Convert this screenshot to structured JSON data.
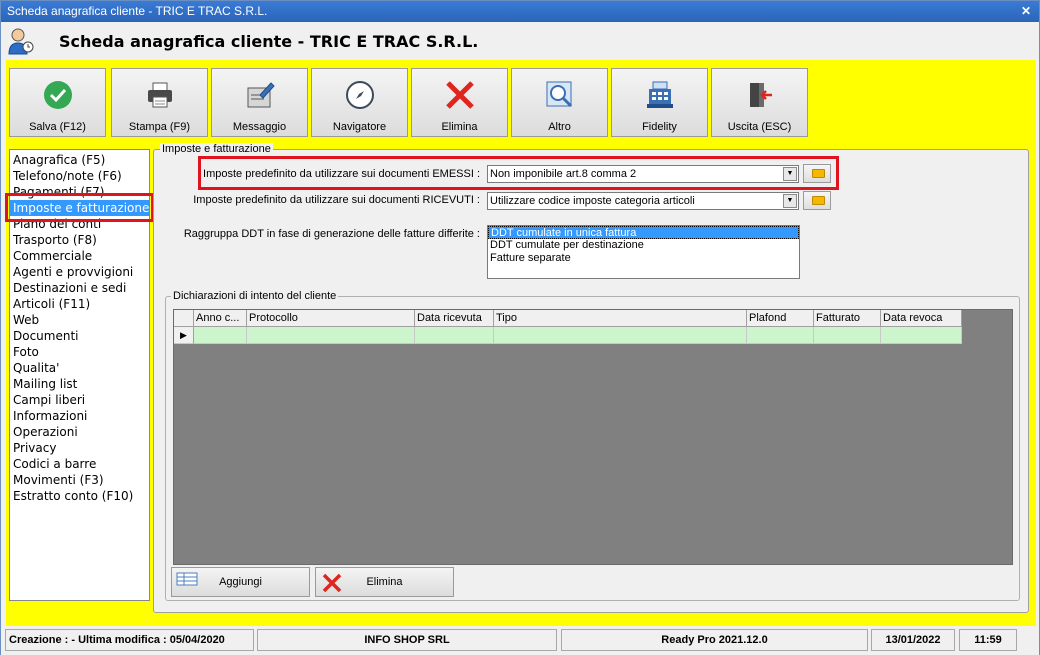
{
  "window": {
    "title": "Scheda anagrafica cliente - TRIC E TRAC S.R.L.",
    "close_glyph": "✕"
  },
  "header": {
    "title": "Scheda anagrafica cliente - TRIC E TRAC S.R.L."
  },
  "toolbar": [
    {
      "label": "Salva (F12)",
      "icon": "check-icon"
    },
    {
      "label": "Stampa (F9)",
      "icon": "printer-icon"
    },
    {
      "label": "Messaggio",
      "icon": "message-icon"
    },
    {
      "label": "Navigatore",
      "icon": "compass-icon"
    },
    {
      "label": "Elimina",
      "icon": "delete-icon"
    },
    {
      "label": "Altro",
      "icon": "search-icon"
    },
    {
      "label": "Fidelity",
      "icon": "cash-register-icon"
    },
    {
      "label": "Uscita (ESC)",
      "icon": "exit-icon"
    }
  ],
  "nav": {
    "items": [
      "Anagrafica (F5)",
      "Telefono/note (F6)",
      "Pagamenti (F7)",
      "Imposte e fatturazione",
      "Piano dei conti",
      "Trasporto (F8)",
      "Commerciale",
      "Agenti e provvigioni",
      "Destinazioni e sedi",
      "Articoli (F11)",
      "Web",
      "Documenti",
      "Foto",
      "Qualita'",
      "Mailing list",
      "Campi liberi",
      "Informazioni",
      "Operazioni",
      "Privacy",
      "Codici a barre",
      "Movimenti (F3)",
      "Estratto conto (F10)"
    ],
    "selected": "Imposte e fatturazione"
  },
  "imposte": {
    "section_title": "Imposte e fatturazione",
    "emessi_label": "Imposte predefinito da utilizzare sui documenti EMESSI :",
    "emessi_value": "Non imponibile art.8 comma 2",
    "ricevuti_label": "Imposte predefinito da utilizzare sui documenti RICEVUTI :",
    "ricevuti_value": "Utilizzare codice imposte categoria articoli",
    "raggruppa_label": "Raggruppa DDT in fase di generazione delle fatture differite :",
    "raggruppa_options": [
      "DDT cumulate in unica fattura",
      "DDT cumulate per destinazione",
      "Fatture separate"
    ],
    "raggruppa_selected": "DDT cumulate in unica fattura"
  },
  "dichiarazioni": {
    "section_title": "Dichiarazioni di intento del cliente",
    "columns": [
      "Anno c...",
      "Protocollo",
      "Data ricevuta",
      "Tipo",
      "Plafond",
      "Fatturato",
      "Data revoca"
    ],
    "row_indicator": "▶",
    "add_label": "Aggiungi",
    "delete_label": "Elimina"
  },
  "status": {
    "creazione": "Creazione : - Ultima modifica : 05/04/2020",
    "company": "INFO SHOP SRL",
    "version": "Ready Pro 2021.12.0",
    "date": "13/01/2022",
    "time": "11:59"
  },
  "colors": {
    "accent_yellow": "#ffff00",
    "selection_blue": "#3399ff",
    "highlight_red": "#e0141e",
    "row_green": "#ccf5cc"
  }
}
